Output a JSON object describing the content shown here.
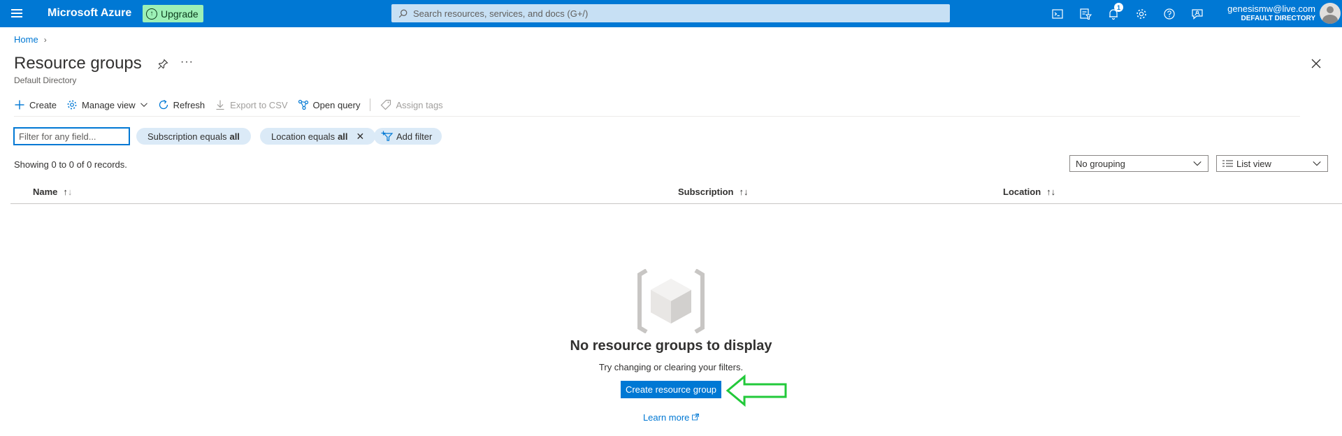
{
  "topbar": {
    "brand": "Microsoft Azure",
    "upgrade_label": "Upgrade",
    "search_placeholder": "Search resources, services, and docs (G+/)",
    "notification_count": "1",
    "account_email": "genesismw@live.com",
    "account_directory": "DEFAULT DIRECTORY",
    "icons": [
      "cloud-shell-icon",
      "directory-filter-icon",
      "notifications-icon",
      "settings-icon",
      "help-icon",
      "feedback-icon"
    ]
  },
  "breadcrumb": {
    "home": "Home"
  },
  "header": {
    "title": "Resource groups",
    "subtitle": "Default Directory",
    "more": "···"
  },
  "commands": {
    "create": "Create",
    "manage_view": "Manage view",
    "refresh": "Refresh",
    "export_csv": "Export to CSV",
    "open_query": "Open query",
    "assign_tags": "Assign tags"
  },
  "filters": {
    "placeholder": "Filter for any field...",
    "subscription_prefix": "Subscription equals ",
    "subscription_value": "all",
    "location_prefix": "Location equals ",
    "location_value": "all",
    "add_filter": "Add filter"
  },
  "records_text": "Showing 0 to 0 of 0 records.",
  "grouping": {
    "selected": "No grouping"
  },
  "view": {
    "selected": "List view"
  },
  "table": {
    "columns": [
      "Name",
      "Subscription",
      "Location"
    ]
  },
  "empty_state": {
    "title": "No resource groups to display",
    "hint": "Try changing or clearing your filters.",
    "create_button": "Create resource group",
    "learn_more": "Learn more"
  },
  "colors": {
    "brand_blue": "#0078d4",
    "upgrade_green": "#9cf0b6",
    "annotation_arrow": "#22c93a"
  }
}
